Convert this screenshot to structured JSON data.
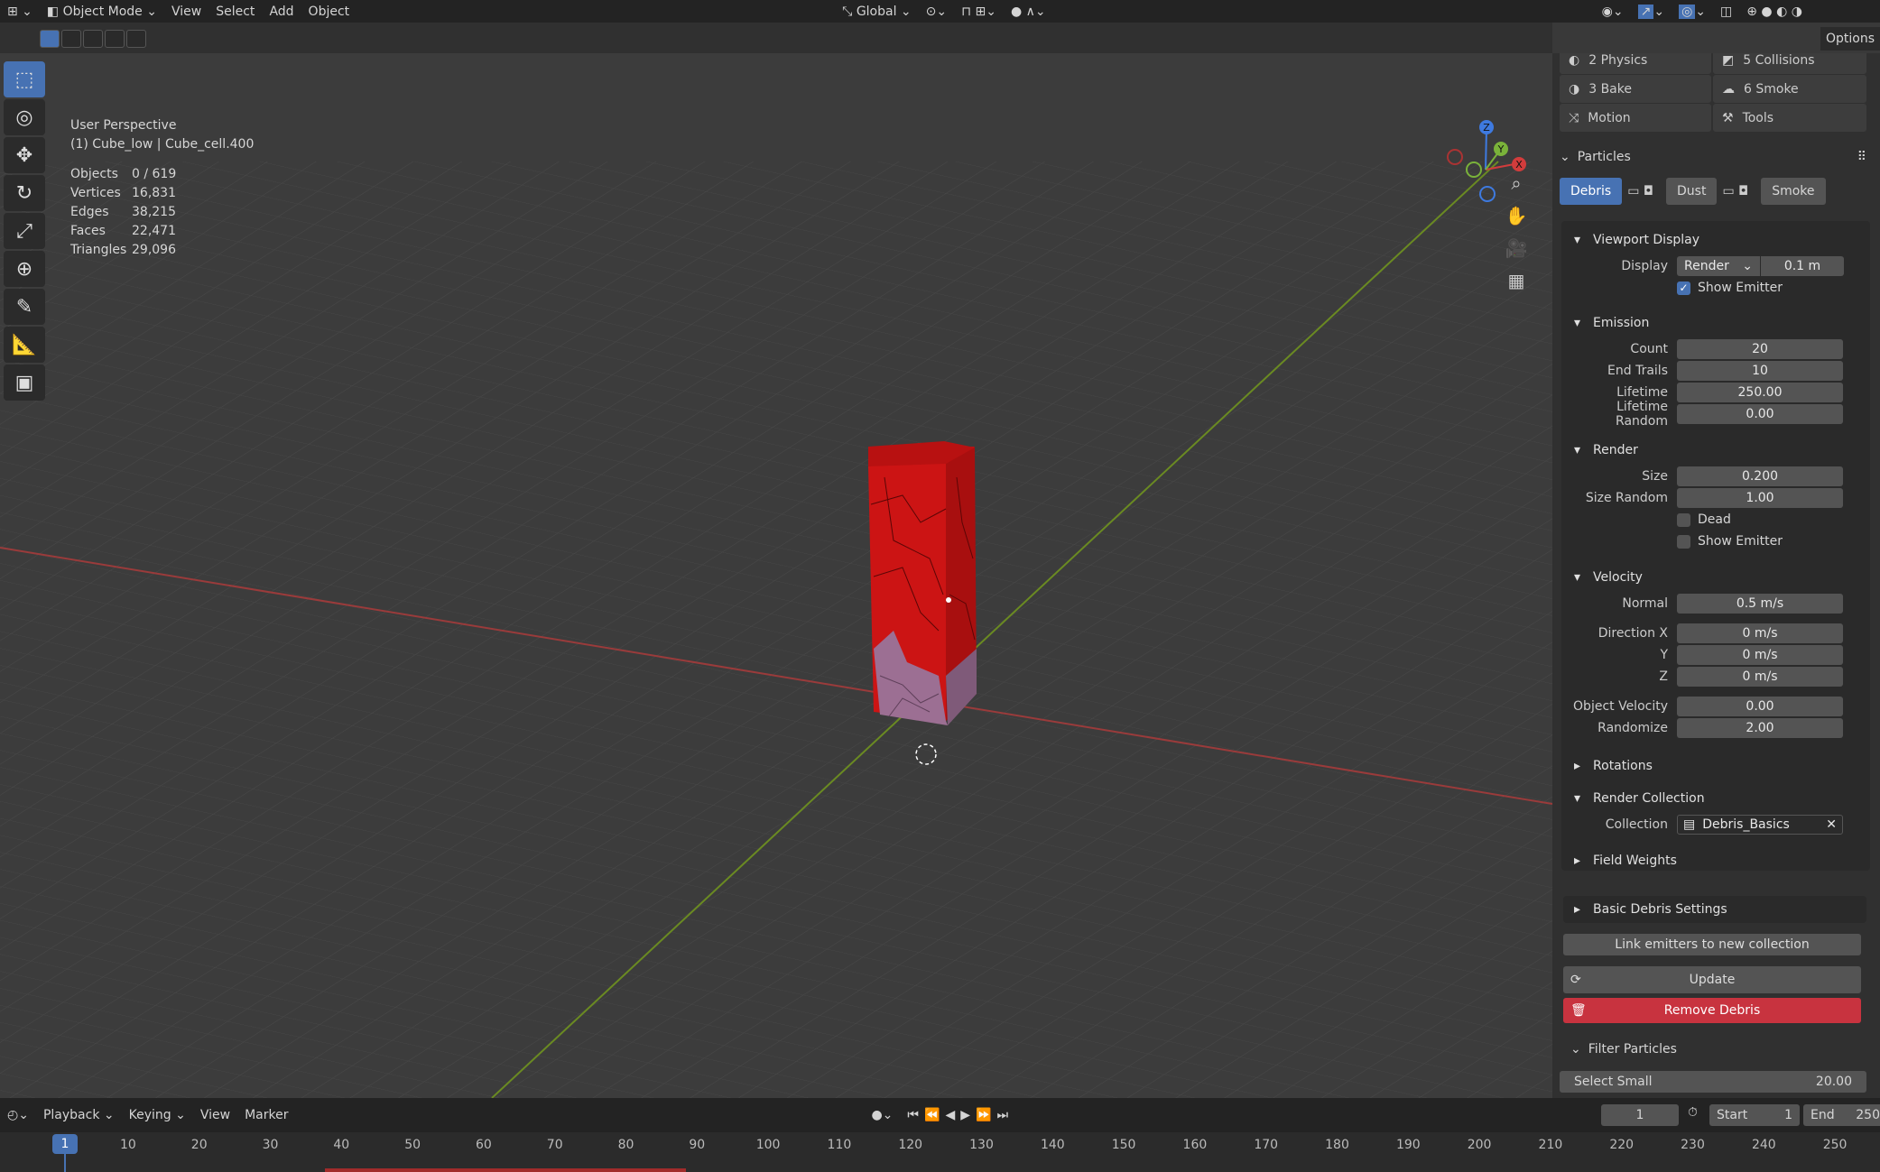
{
  "menu": {
    "mode": "Object Mode",
    "items": [
      "View",
      "Select",
      "Add",
      "Object"
    ],
    "transform_orientation": "Global"
  },
  "header": {
    "options": "Options"
  },
  "viewport": {
    "perspective": "User Perspective",
    "object_name": "(1) Cube_low | Cube_cell.400",
    "stats": [
      {
        "label": "Objects",
        "value": "0 / 619"
      },
      {
        "label": "Vertices",
        "value": "16,831"
      },
      {
        "label": "Edges",
        "value": "38,215"
      },
      {
        "label": "Faces",
        "value": "22,471"
      },
      {
        "label": "Triangles",
        "value": "29,096"
      }
    ],
    "gizmo": {
      "x": "X",
      "y": "Y",
      "z": "Z"
    }
  },
  "panel": {
    "tabs": [
      {
        "label": "2 Physics",
        "icon": "physics-icon"
      },
      {
        "label": "5 Collisions",
        "icon": "collision-icon"
      },
      {
        "label": "3 Bake",
        "icon": "bake-icon"
      },
      {
        "label": "6 Smoke",
        "icon": "smoke-icon"
      },
      {
        "label": "Motion",
        "icon": "motion-icon"
      },
      {
        "label": "Tools",
        "icon": "tools-icon"
      }
    ],
    "particles_title": "Particles",
    "particle_tabs": [
      "Debris",
      "Dust",
      "Smoke"
    ],
    "viewport_display": {
      "title": "Viewport Display",
      "display_label": "Display",
      "display_value": "Render",
      "display_size": "0.1 m",
      "show_emitter": "Show Emitter"
    },
    "emission": {
      "title": "Emission",
      "rows": [
        {
          "label": "Count",
          "value": "20"
        },
        {
          "label": "End Trails",
          "value": "10"
        },
        {
          "label": "Lifetime",
          "value": "250.00"
        },
        {
          "label": "Lifetime Random",
          "value": "0.00"
        }
      ]
    },
    "render": {
      "title": "Render",
      "rows": [
        {
          "label": "Size",
          "value": "0.200"
        },
        {
          "label": "Size Random",
          "value": "1.00"
        }
      ],
      "dead": "Dead",
      "show_emitter": "Show Emitter"
    },
    "velocity": {
      "title": "Velocity",
      "rows": [
        {
          "label": "Normal",
          "value": "0.5 m/s"
        },
        {
          "label": "Direction X",
          "value": "0 m/s"
        },
        {
          "label": "Y",
          "value": "0 m/s"
        },
        {
          "label": "Z",
          "value": "0 m/s"
        },
        {
          "label": "Object Velocity",
          "value": "0.00"
        },
        {
          "label": "Randomize",
          "value": "2.00"
        }
      ]
    },
    "rotations": "Rotations",
    "render_collection": {
      "title": "Render Collection",
      "label": "Collection",
      "value": "Debris_Basics"
    },
    "field_weights": "Field Weights",
    "basic_debris": "Basic Debris Settings",
    "link_emitters": "Link emitters to new collection",
    "update": "Update",
    "remove": "Remove Debris",
    "filter_title": "Filter Particles",
    "select_small_label": "Select Small",
    "select_small_value": "20.00"
  },
  "timeline": {
    "menus": [
      "Playback",
      "Keying",
      "View",
      "Marker"
    ],
    "current_frame": "1",
    "start_label": "Start",
    "start_value": "1",
    "end_label": "End",
    "end_value": "250",
    "frame_marks": [
      "10",
      "20",
      "30",
      "40",
      "50",
      "60",
      "70",
      "80",
      "90",
      "100",
      "110",
      "120",
      "130",
      "140",
      "150",
      "160",
      "170",
      "180",
      "190",
      "200",
      "210",
      "220",
      "230",
      "240",
      "250"
    ],
    "playhead": "1"
  },
  "colors": {
    "accent": "#4772b3",
    "danger": "#c8333f",
    "cube": "#cc1414",
    "cube_fractured": "#9c6f93"
  }
}
